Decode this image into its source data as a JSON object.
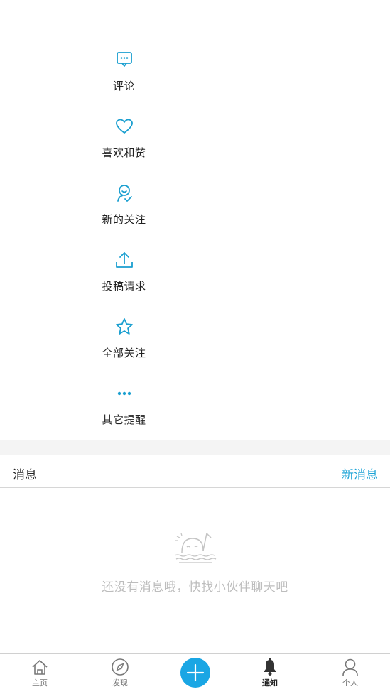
{
  "categories": [
    {
      "label": "评论",
      "icon": "comment-icon"
    },
    {
      "label": "喜欢和赞",
      "icon": "heart-icon"
    },
    {
      "label": "新的关注",
      "icon": "new-follower-icon"
    },
    {
      "label": "投稿请求",
      "icon": "upload-icon"
    },
    {
      "label": "全部关注",
      "icon": "star-icon"
    },
    {
      "label": "其它提醒",
      "icon": "more-icon"
    }
  ],
  "messages": {
    "title": "消息",
    "new_message": "新消息",
    "empty_text": "还没有消息哦，快找小伙伴聊天吧",
    "empty_icon": "empty-whale-icon"
  },
  "tabbar": {
    "items": [
      {
        "label": "主页",
        "icon": "home-icon",
        "active": false
      },
      {
        "label": "发现",
        "icon": "compass-icon",
        "active": false
      },
      {
        "label": "",
        "icon": "plus-icon",
        "active": false
      },
      {
        "label": "通知",
        "icon": "bell-icon",
        "active": true
      },
      {
        "label": "个人",
        "icon": "person-icon",
        "active": false
      }
    ]
  },
  "colors": {
    "accent": "#1ba3d6",
    "plus_button": "#1aa6e4",
    "icon_blue": "#1a9fd0",
    "muted_text": "#bdbdbd"
  }
}
